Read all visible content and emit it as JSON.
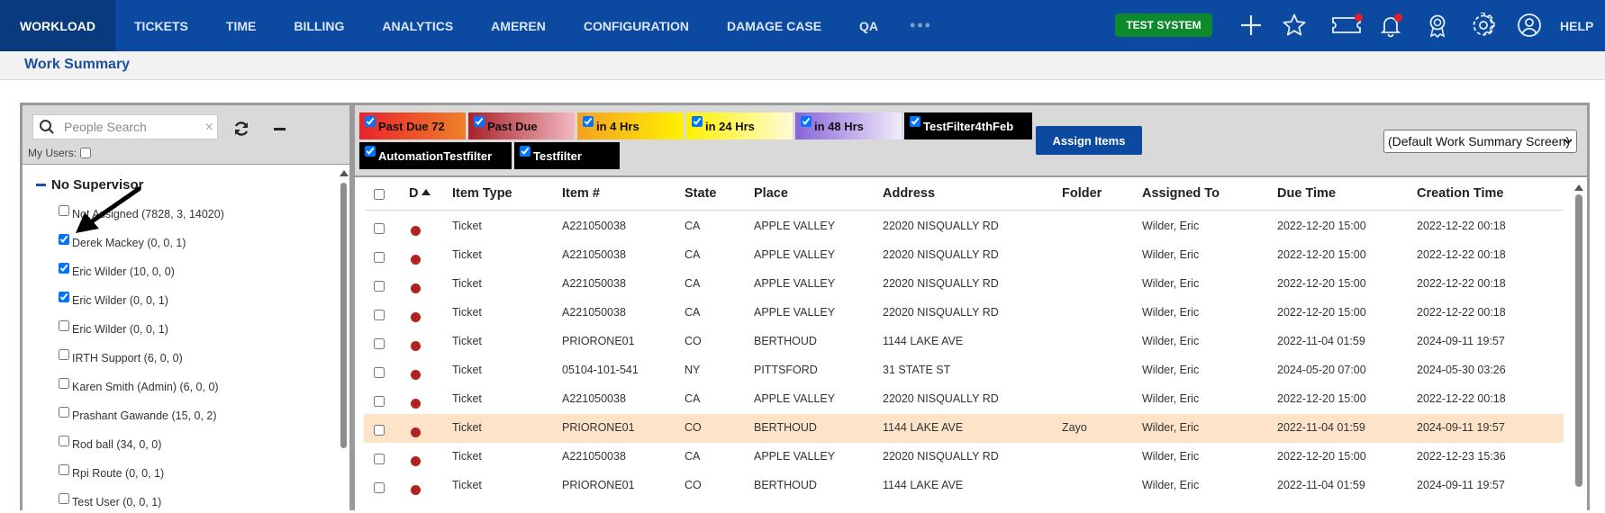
{
  "nav": {
    "items": [
      "WORKLOAD",
      "TICKETS",
      "TIME",
      "BILLING",
      "ANALYTICS",
      "AMEREN",
      "CONFIGURATION",
      "DAMAGE CASE",
      "QA"
    ],
    "more": "•••",
    "test_system": "TEST SYSTEM",
    "help": "HELP",
    "icons": [
      "plus-icon",
      "star-icon",
      "ticket-icon",
      "bell-icon",
      "award-icon",
      "gear-icon",
      "user-icon"
    ]
  },
  "subheader": {
    "title": "Work Summary"
  },
  "left": {
    "search_placeholder": "People Search",
    "clear": "×",
    "my_users_label": "My Users:",
    "group_title": "No Supervisor",
    "users": [
      {
        "label": "Not Assigned (7828, 3, 14020)",
        "checked": false
      },
      {
        "label": "Derek Mackey (0, 0, 1)",
        "checked": true
      },
      {
        "label": "Eric Wilder (10, 0, 0)",
        "checked": true
      },
      {
        "label": "Eric Wilder (0, 0, 1)",
        "checked": true
      },
      {
        "label": "Eric Wilder (0, 0, 1)",
        "checked": false
      },
      {
        "label": "IRTH Support (6, 0, 0)",
        "checked": false
      },
      {
        "label": "Karen Smith (Admin) (6, 0, 0)",
        "checked": false
      },
      {
        "label": "Prashant Gawande (15, 0, 2)",
        "checked": false
      },
      {
        "label": "Rod ball (34, 0, 0)",
        "checked": false
      },
      {
        "label": "Rpi Route (0, 0, 1)",
        "checked": false
      },
      {
        "label": "Test User (0, 0, 1)",
        "checked": false
      }
    ]
  },
  "filters": [
    {
      "label": "Past Due 72",
      "bg": "linear-gradient(90deg,#e8232a,#f0802a)"
    },
    {
      "label": "Past Due",
      "bg": "linear-gradient(90deg,#a8222a,#f3b8c0)"
    },
    {
      "label": "in 4 Hrs",
      "bg": "linear-gradient(90deg,#f6a020,#fff200)"
    },
    {
      "label": "in 24 Hrs",
      "bg": "linear-gradient(90deg,#fff200,#fffbd8)"
    },
    {
      "label": "in 48 Hrs",
      "bg": "linear-gradient(90deg,#8a63d9,#f0ecfb)"
    },
    {
      "label": "TestFilter4thFeb",
      "bg": "#000000"
    },
    {
      "label": "AutomationTestfilter",
      "bg": "#000000"
    },
    {
      "label": "Testfilter",
      "bg": "#000000"
    }
  ],
  "assign_button": "Assign Items",
  "view_select": "(Default Work Summary Screen)",
  "table": {
    "headers": [
      "D",
      "Item Type",
      "Item #",
      "State",
      "Place",
      "Address",
      "Folder",
      "Assigned To",
      "Due Time",
      "Creation Time"
    ],
    "rows": [
      {
        "type": "Ticket",
        "item": "A221050038",
        "state": "CA",
        "place": "APPLE VALLEY",
        "address": "22020 NISQUALLY RD",
        "folder": "",
        "assigned": "Wilder, Eric",
        "due": "2022-12-20 15:00",
        "created": "2022-12-22 00:18"
      },
      {
        "type": "Ticket",
        "item": "A221050038",
        "state": "CA",
        "place": "APPLE VALLEY",
        "address": "22020 NISQUALLY RD",
        "folder": "",
        "assigned": "Wilder, Eric",
        "due": "2022-12-20 15:00",
        "created": "2022-12-22 00:18"
      },
      {
        "type": "Ticket",
        "item": "A221050038",
        "state": "CA",
        "place": "APPLE VALLEY",
        "address": "22020 NISQUALLY RD",
        "folder": "",
        "assigned": "Wilder, Eric",
        "due": "2022-12-20 15:00",
        "created": "2022-12-22 00:18"
      },
      {
        "type": "Ticket",
        "item": "A221050038",
        "state": "CA",
        "place": "APPLE VALLEY",
        "address": "22020 NISQUALLY RD",
        "folder": "",
        "assigned": "Wilder, Eric",
        "due": "2022-12-20 15:00",
        "created": "2022-12-22 00:18"
      },
      {
        "type": "Ticket",
        "item": "PRIORONE01",
        "state": "CO",
        "place": "BERTHOUD",
        "address": "1144 LAKE AVE",
        "folder": "",
        "assigned": "Wilder, Eric",
        "due": "2022-11-04 01:59",
        "created": "2024-09-11 19:57"
      },
      {
        "type": "Ticket",
        "item": "05104-101-541",
        "state": "NY",
        "place": "PITTSFORD",
        "address": "31 STATE ST",
        "folder": "",
        "assigned": "Wilder, Eric",
        "due": "2024-05-20 07:00",
        "created": "2024-05-30 03:26"
      },
      {
        "type": "Ticket",
        "item": "A221050038",
        "state": "CA",
        "place": "APPLE VALLEY",
        "address": "22020 NISQUALLY RD",
        "folder": "",
        "assigned": "Wilder, Eric",
        "due": "2022-12-20 15:00",
        "created": "2022-12-22 00:18"
      },
      {
        "type": "Ticket",
        "item": "PRIORONE01",
        "state": "CO",
        "place": "BERTHOUD",
        "address": "1144 LAKE AVE",
        "folder": "Zayo",
        "assigned": "Wilder, Eric",
        "due": "2022-11-04 01:59",
        "created": "2024-09-11 19:57",
        "highlight": true
      },
      {
        "type": "Ticket",
        "item": "A221050038",
        "state": "CA",
        "place": "APPLE VALLEY",
        "address": "22020 NISQUALLY RD",
        "folder": "",
        "assigned": "Wilder, Eric",
        "due": "2022-12-20 15:00",
        "created": "2022-12-23 15:36"
      },
      {
        "type": "Ticket",
        "item": "PRIORONE01",
        "state": "CO",
        "place": "BERTHOUD",
        "address": "1144 LAKE AVE",
        "folder": "",
        "assigned": "Wilder, Eric",
        "due": "2022-11-04 01:59",
        "created": "2024-09-11 19:57"
      }
    ]
  },
  "colors": {
    "nav_bg": "#0b4aa0",
    "test_system": "#0c8a2c",
    "row_highlight": "#fde3c8",
    "status_dot": "#b3221f"
  }
}
